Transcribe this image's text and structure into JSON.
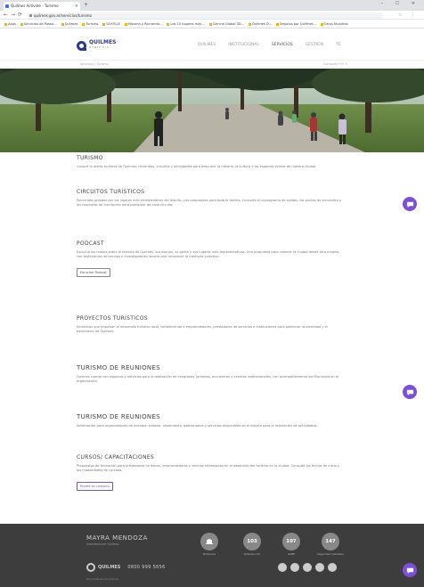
{
  "browser": {
    "tab_title": "Quilmes Activate - Turismo",
    "new_tab": "+",
    "window_controls": "– ☐ ✕",
    "url": "quilmes.gov.ar/servicios/turismo",
    "nav": {
      "back": "←",
      "forward": "→",
      "reload": "⟳"
    },
    "bookmarks": [
      "Apps",
      "Servicios de Paseo...",
      "Quilmes",
      "Turismo",
      "GOOGLE",
      "Historia y Recuerdo...",
      "Los 10 lugares más...",
      "Ciencia Global 3D...",
      "Quilmes D...",
      "Seguros por Quilmes...",
      "Otros favoritos"
    ]
  },
  "header": {
    "logo_text": "QUILMES",
    "logo_subtext": "MUNICIPIO",
    "nav": [
      {
        "label": "QUILMES",
        "active": false
      },
      {
        "label": "INSTITUCIONAL",
        "active": false
      },
      {
        "label": "SERVICIOS",
        "active": true
      },
      {
        "label": "GESTIÓN",
        "active": false
      },
      {
        "label": "TE",
        "active": false
      }
    ]
  },
  "breadcrumb": {
    "left": "Servicios / Turismo",
    "right": "Compartir  f  ✉  ✕"
  },
  "sections": [
    {
      "title": "TURISMO",
      "big": false,
      "text": "Conocé la oferta turística de Quilmes: recorridos, circuitos y actividades para descubrir la historia, la cultura y los espacios verdes de nuestra ciudad."
    },
    {
      "title": "CIRCUITOS TURÍSTICOS",
      "big": false,
      "text": "Recorridos guiados por los lugares más emblemáticos del distrito, con propuestas para toda la familia. Consultá el cronograma de salidas, los puntos de encuentro y los requisitos de inscripción para participar de cada circuito."
    },
    {
      "title": "PODCAST",
      "big": false,
      "text": "Escuchá los relatos sobre la historia de Quilmes, sus barrios, su gente y sus lugares más representativos. Una propuesta para conocer la ciudad desde otra mirada, con testimonios de vecinos e investigadores locales que recuperan la memoria colectiva.",
      "button": "Escuchar Podcast"
    },
    {
      "title": "PROYECTOS TURÍSTICOS",
      "big": false,
      "text": "Iniciativas que impulsan el desarrollo turístico local, fortaleciendo a emprendedores, prestadores de servicios e instituciones para potenciar la identidad y el patrimonio de Quilmes."
    },
    {
      "title": "TURISMO DE REUNIONES",
      "big": true,
      "text": "Quilmes cuenta con espacios y servicios para la realización de congresos, jornadas, encuentros y eventos institucionales, con acompañamiento del Municipio en la organización."
    },
    {
      "title": "TURISMO DE REUNIONES",
      "big": true,
      "text": "Información para organizadores de eventos: salones, alojamiento, gastronomía y servicios disponibles en el distrito para la realización de actividades."
    },
    {
      "title": "CURSOS/ CAPACITACIONES",
      "big": false,
      "text": "Propuestas de formación para prestadores turísticos, emprendedores y vecinos interesados en el desarrollo del turismo en la ciudad. Consultá las fechas de inicio y las modalidades de cursada.",
      "button": "Ponete en contacto"
    }
  ],
  "footer": {
    "name": "MAYRA MENDOZA",
    "role": "Intendenta de Quilmes",
    "logo_text": "QUILMES",
    "phone": "0800 999 5656",
    "copyright": "Municipalidad de Quilmes",
    "badges": [
      {
        "number": "",
        "label": "Bomberos"
      },
      {
        "number": "103",
        "label": "Defensa civil"
      },
      {
        "number": "107",
        "label": "SAME"
      },
      {
        "number": "147",
        "label": "Seguridad ciudadana"
      }
    ]
  },
  "colors": {
    "brand": "#2c3a8c",
    "chat": "#7b4fd6",
    "footer": "#3d3d3d"
  }
}
